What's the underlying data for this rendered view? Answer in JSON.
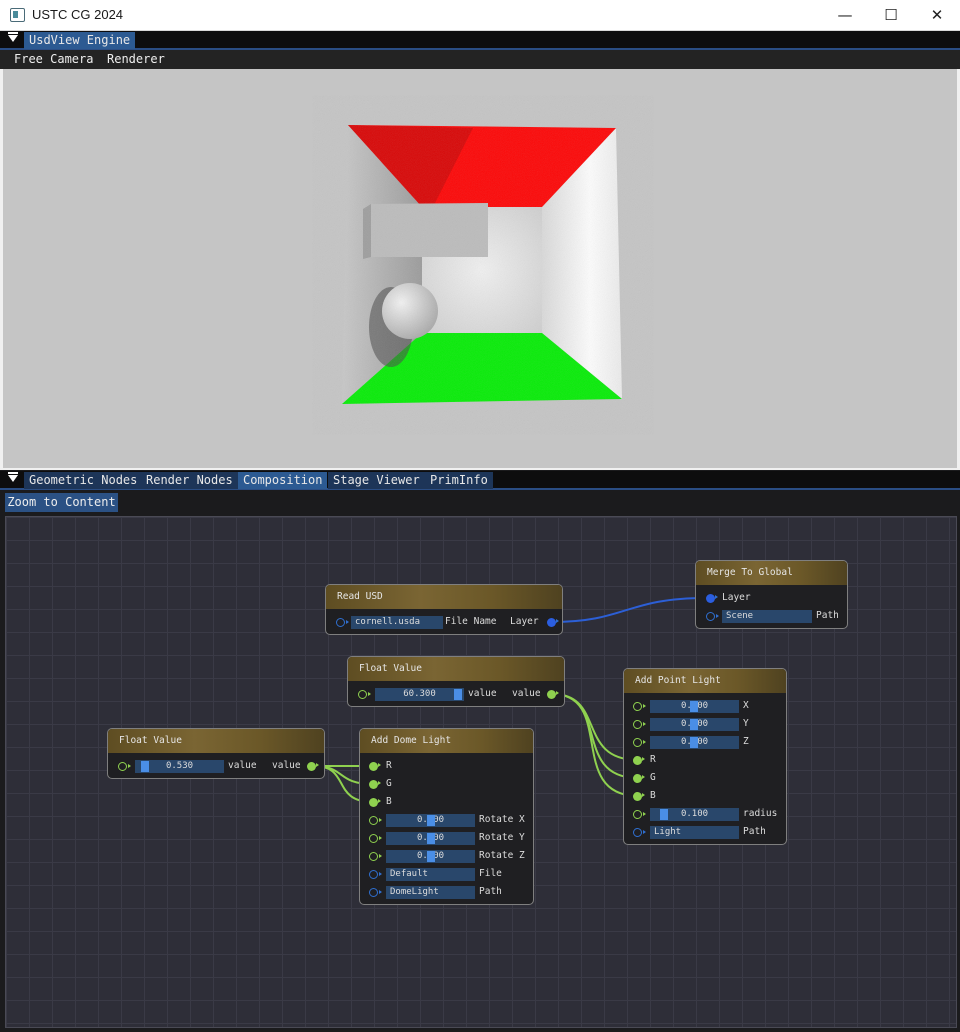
{
  "window": {
    "title": "USTC CG 2024",
    "minimize": "—",
    "maximize": "☐",
    "close": "✕"
  },
  "top_tabs": [
    "UsdView Engine"
  ],
  "menu": [
    "Free Camera",
    "Renderer"
  ],
  "bottom_tabs": [
    "Geometric Nodes",
    "Render Nodes",
    "Composition",
    "Stage Viewer",
    "PrimInfo"
  ],
  "active_bottom_tab": "Composition",
  "zoom_button": "Zoom to Content",
  "scene_colors": {
    "left_wall": "#ff0000",
    "floor": "#00ee00",
    "walls": "#e8e8e8",
    "background": "#c5c5c5"
  },
  "nodes": {
    "read_usd": {
      "title": "Read USD",
      "file_value": "cornell.usda",
      "file_label": "File Name",
      "out_label": "Layer"
    },
    "merge": {
      "title": "Merge To Global",
      "in_label": "Layer",
      "path_value": "Scene",
      "path_label": "Path"
    },
    "float_top": {
      "title": "Float Value",
      "value": "60.300",
      "in_label": "value",
      "out_label": "value"
    },
    "float_left": {
      "title": "Float Value",
      "value": "0.530",
      "in_label": "value",
      "out_label": "value"
    },
    "dome": {
      "title": "Add Dome Light",
      "r": "R",
      "g": "G",
      "b": "B",
      "rot_x": "0.000",
      "rot_x_label": "Rotate X",
      "rot_y": "0.000",
      "rot_y_label": "Rotate Y",
      "rot_z": "0.000",
      "rot_z_label": "Rotate Z",
      "file_value": "Default",
      "file_label": "File",
      "path_value": "DomeLight",
      "path_label": "Path"
    },
    "point": {
      "title": "Add Point Light",
      "x": "0.300",
      "x_label": "X",
      "y": "0.300",
      "y_label": "Y",
      "z": "0.400",
      "z_label": "Z",
      "r": "R",
      "g": "G",
      "b": "B",
      "radius": "0.100",
      "radius_label": "radius",
      "path_value": "Light",
      "path_label": "Path"
    }
  }
}
